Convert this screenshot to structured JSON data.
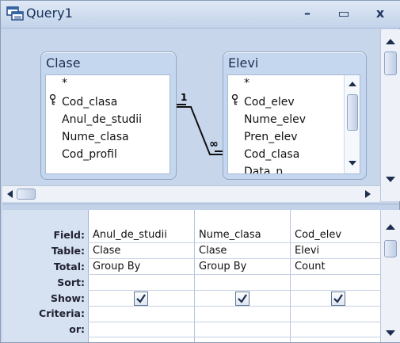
{
  "window": {
    "title": "Query1",
    "minimize_label": "–",
    "maximize_label": "▭",
    "close_label": "x"
  },
  "tables": {
    "clase": {
      "name": "Clase",
      "fields": [
        "*",
        "Cod_clasa",
        "Anul_de_studii",
        "Nume_clasa",
        "Cod_profil"
      ],
      "primary_key_index": 1
    },
    "elevi": {
      "name": "Elevi",
      "fields": [
        "*",
        "Cod_elev",
        "Nume_elev",
        "Pren_elev",
        "Cod_clasa",
        "Data_n"
      ],
      "primary_key_index": 1
    }
  },
  "relationship": {
    "from": "Cod_clasa",
    "to": "Cod_clasa",
    "one_label": "1",
    "many_label": "∞"
  },
  "grid": {
    "row_labels": [
      "Field:",
      "Table:",
      "Total:",
      "Sort:",
      "Show:",
      "Criteria:",
      "or:"
    ],
    "columns": [
      {
        "field": "Anul_de_studii",
        "table": "Clase",
        "total": "Group By",
        "sort": "",
        "show": true
      },
      {
        "field": "Nume_clasa",
        "table": "Clase",
        "total": "Group By",
        "sort": "",
        "show": true
      },
      {
        "field": "Cod_elev",
        "table": "Elevi",
        "total": "Count",
        "sort": "",
        "show": true
      }
    ]
  },
  "colors": {
    "window_bg": "#c9d7ea",
    "accent": "#15305c"
  }
}
